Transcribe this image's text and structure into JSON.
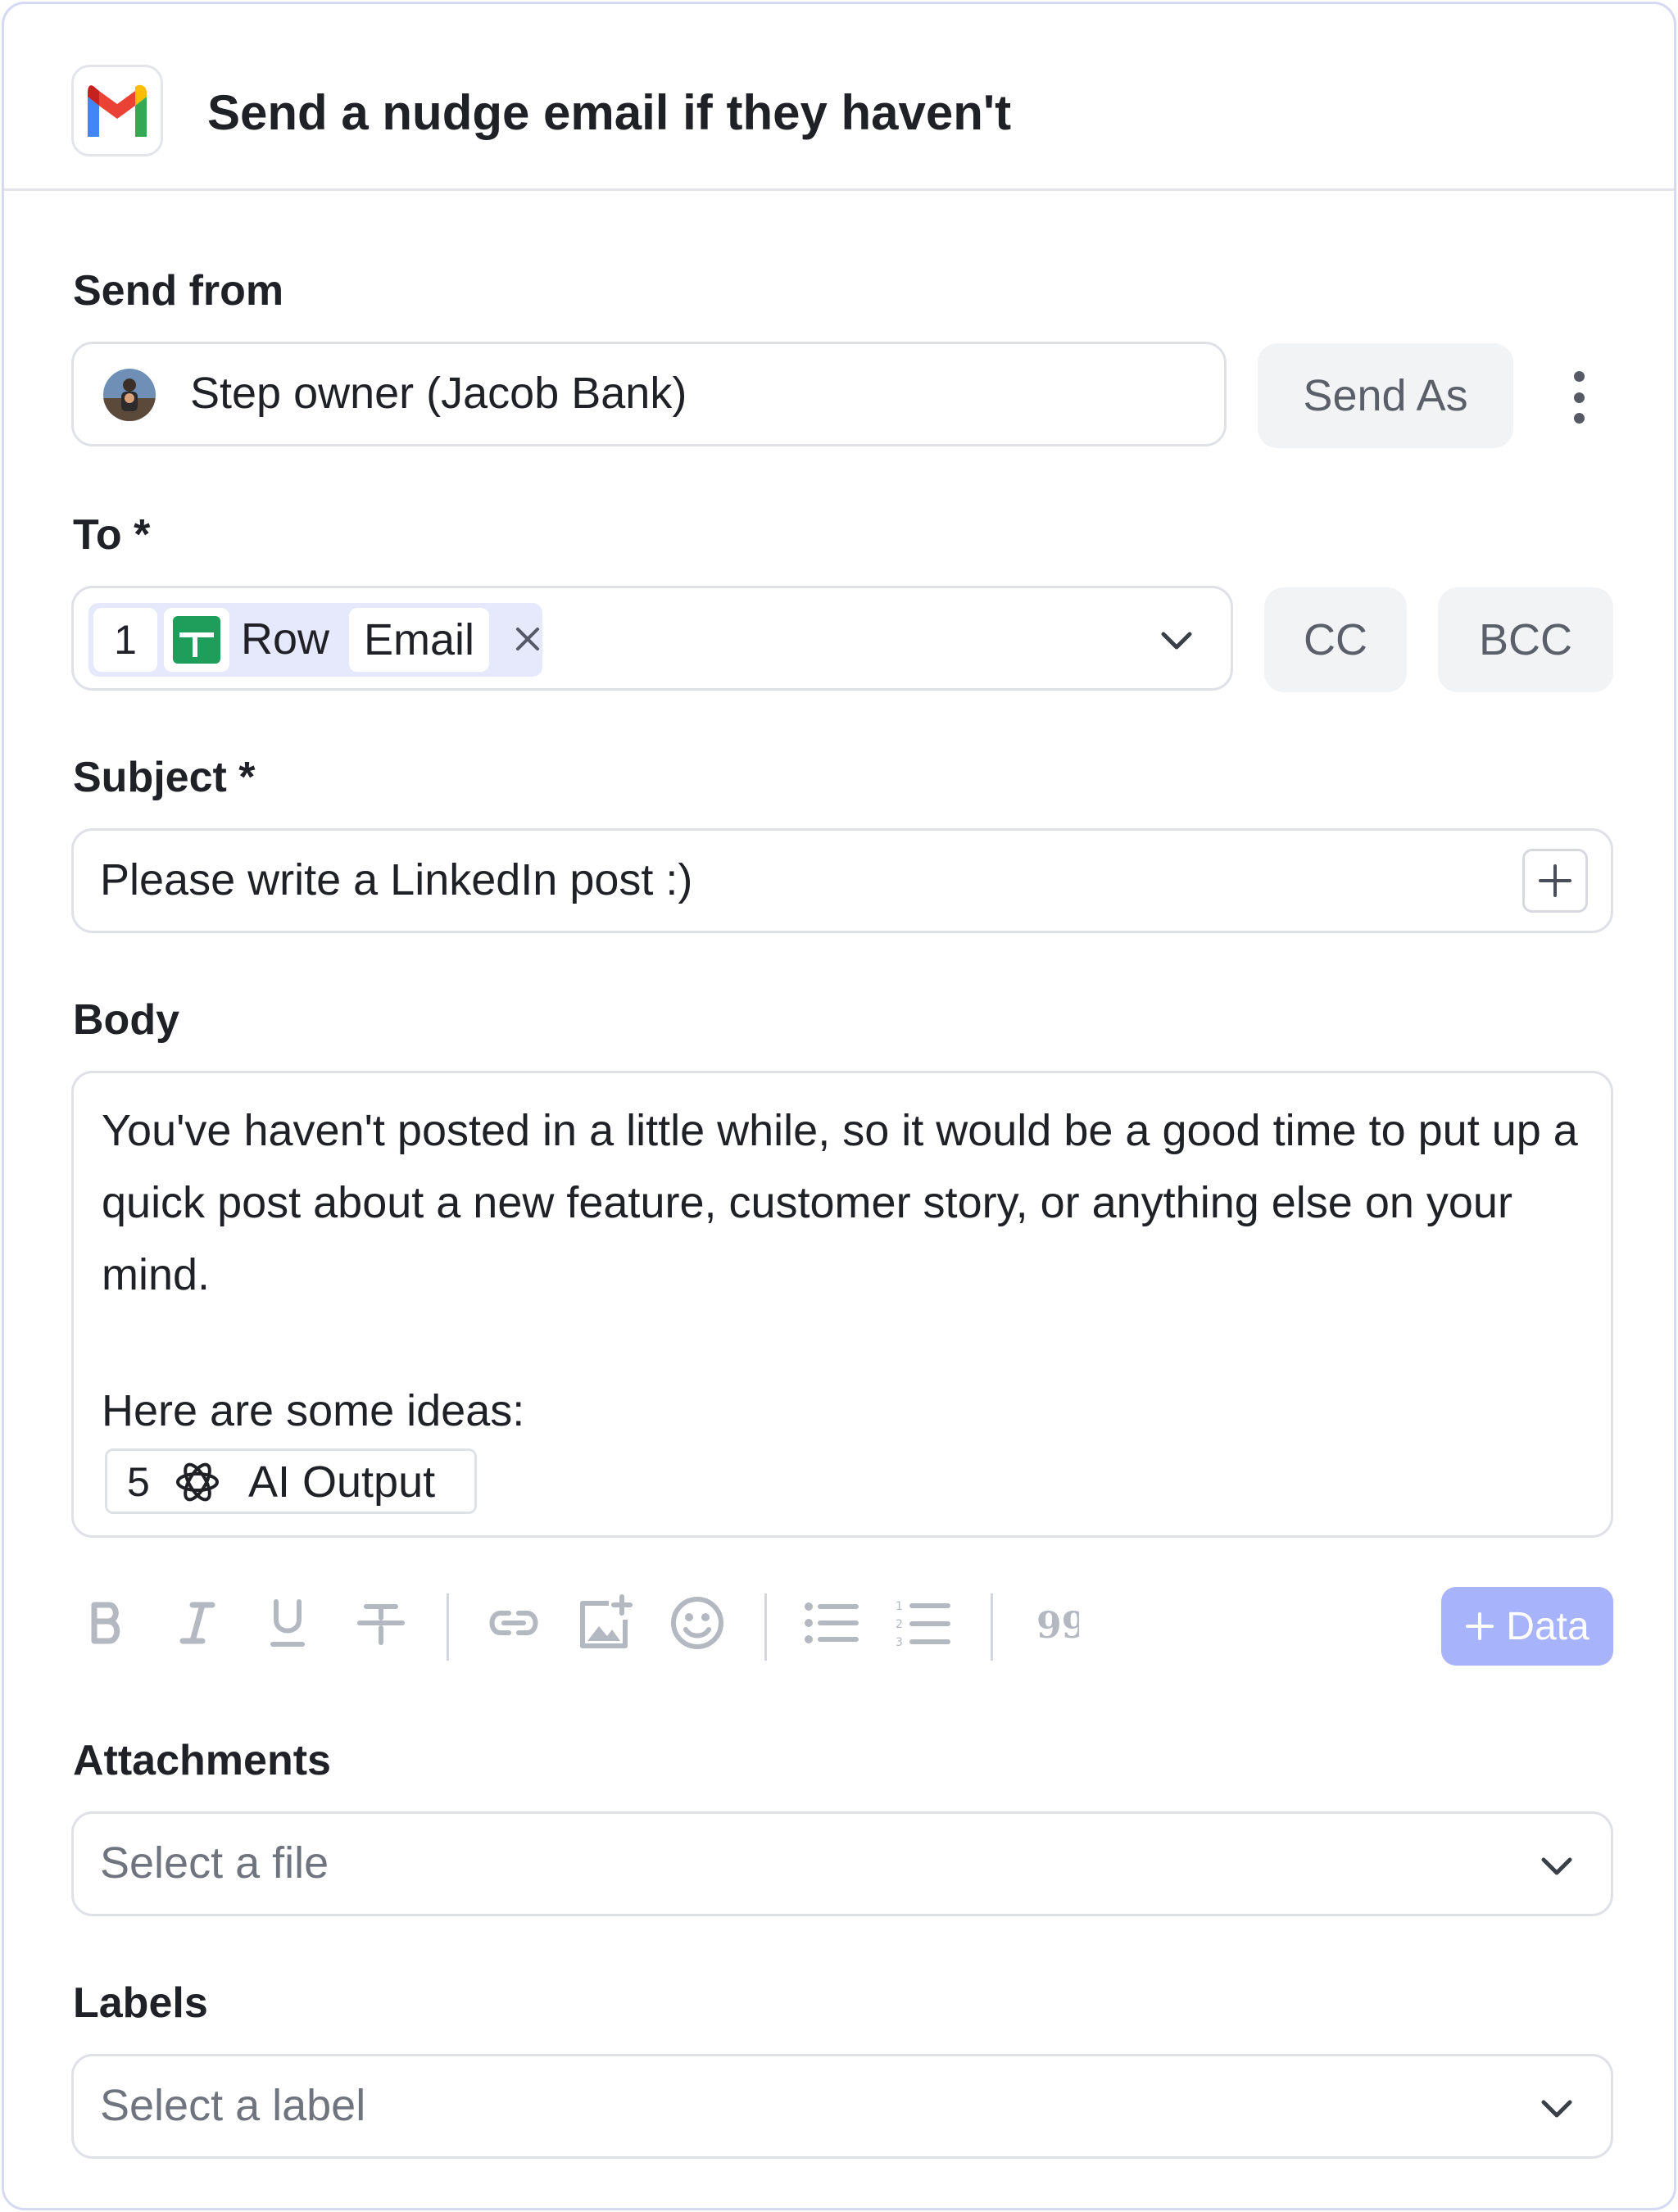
{
  "header": {
    "title": "Send a nudge email if they haven't",
    "app_icon": "gmail-icon"
  },
  "send_from": {
    "label": "Send from",
    "value": "Step owner (Jacob Bank)",
    "send_as_label": "Send As",
    "more_icon": "kebab-menu-icon"
  },
  "to": {
    "label": "To *",
    "chip": {
      "step_number": "1",
      "source_icon": "google-sheets-icon",
      "source": "Row",
      "field": "Email"
    },
    "cc_label": "CC",
    "bcc_label": "BCC"
  },
  "subject": {
    "label": "Subject *",
    "value": "Please write a LinkedIn post :)"
  },
  "body": {
    "label": "Body",
    "paragraph": "You've haven't posted in a little while, so it would be a good time to put up a quick post about a new feature, customer story, or anything else on your mind.",
    "ideas_line": "Here are some ideas:",
    "chip": {
      "step_number": "5",
      "source_icon": "openai-icon",
      "field": "AI Output"
    }
  },
  "toolbar": {
    "items": [
      "bold-icon",
      "italic-icon",
      "underline-icon",
      "strikethrough-icon",
      "link-icon",
      "image-icon",
      "emoji-icon",
      "bullet-list-icon",
      "numbered-list-icon",
      "quote-icon"
    ],
    "data_button_label": "Data"
  },
  "attachments": {
    "label": "Attachments",
    "placeholder": "Select a file"
  },
  "labels": {
    "label": "Labels",
    "placeholder": "Select a label"
  },
  "colors": {
    "accent_button": "#a7b3fb",
    "chip_bg": "#e6e9fb",
    "border": "#dfe1e7"
  }
}
